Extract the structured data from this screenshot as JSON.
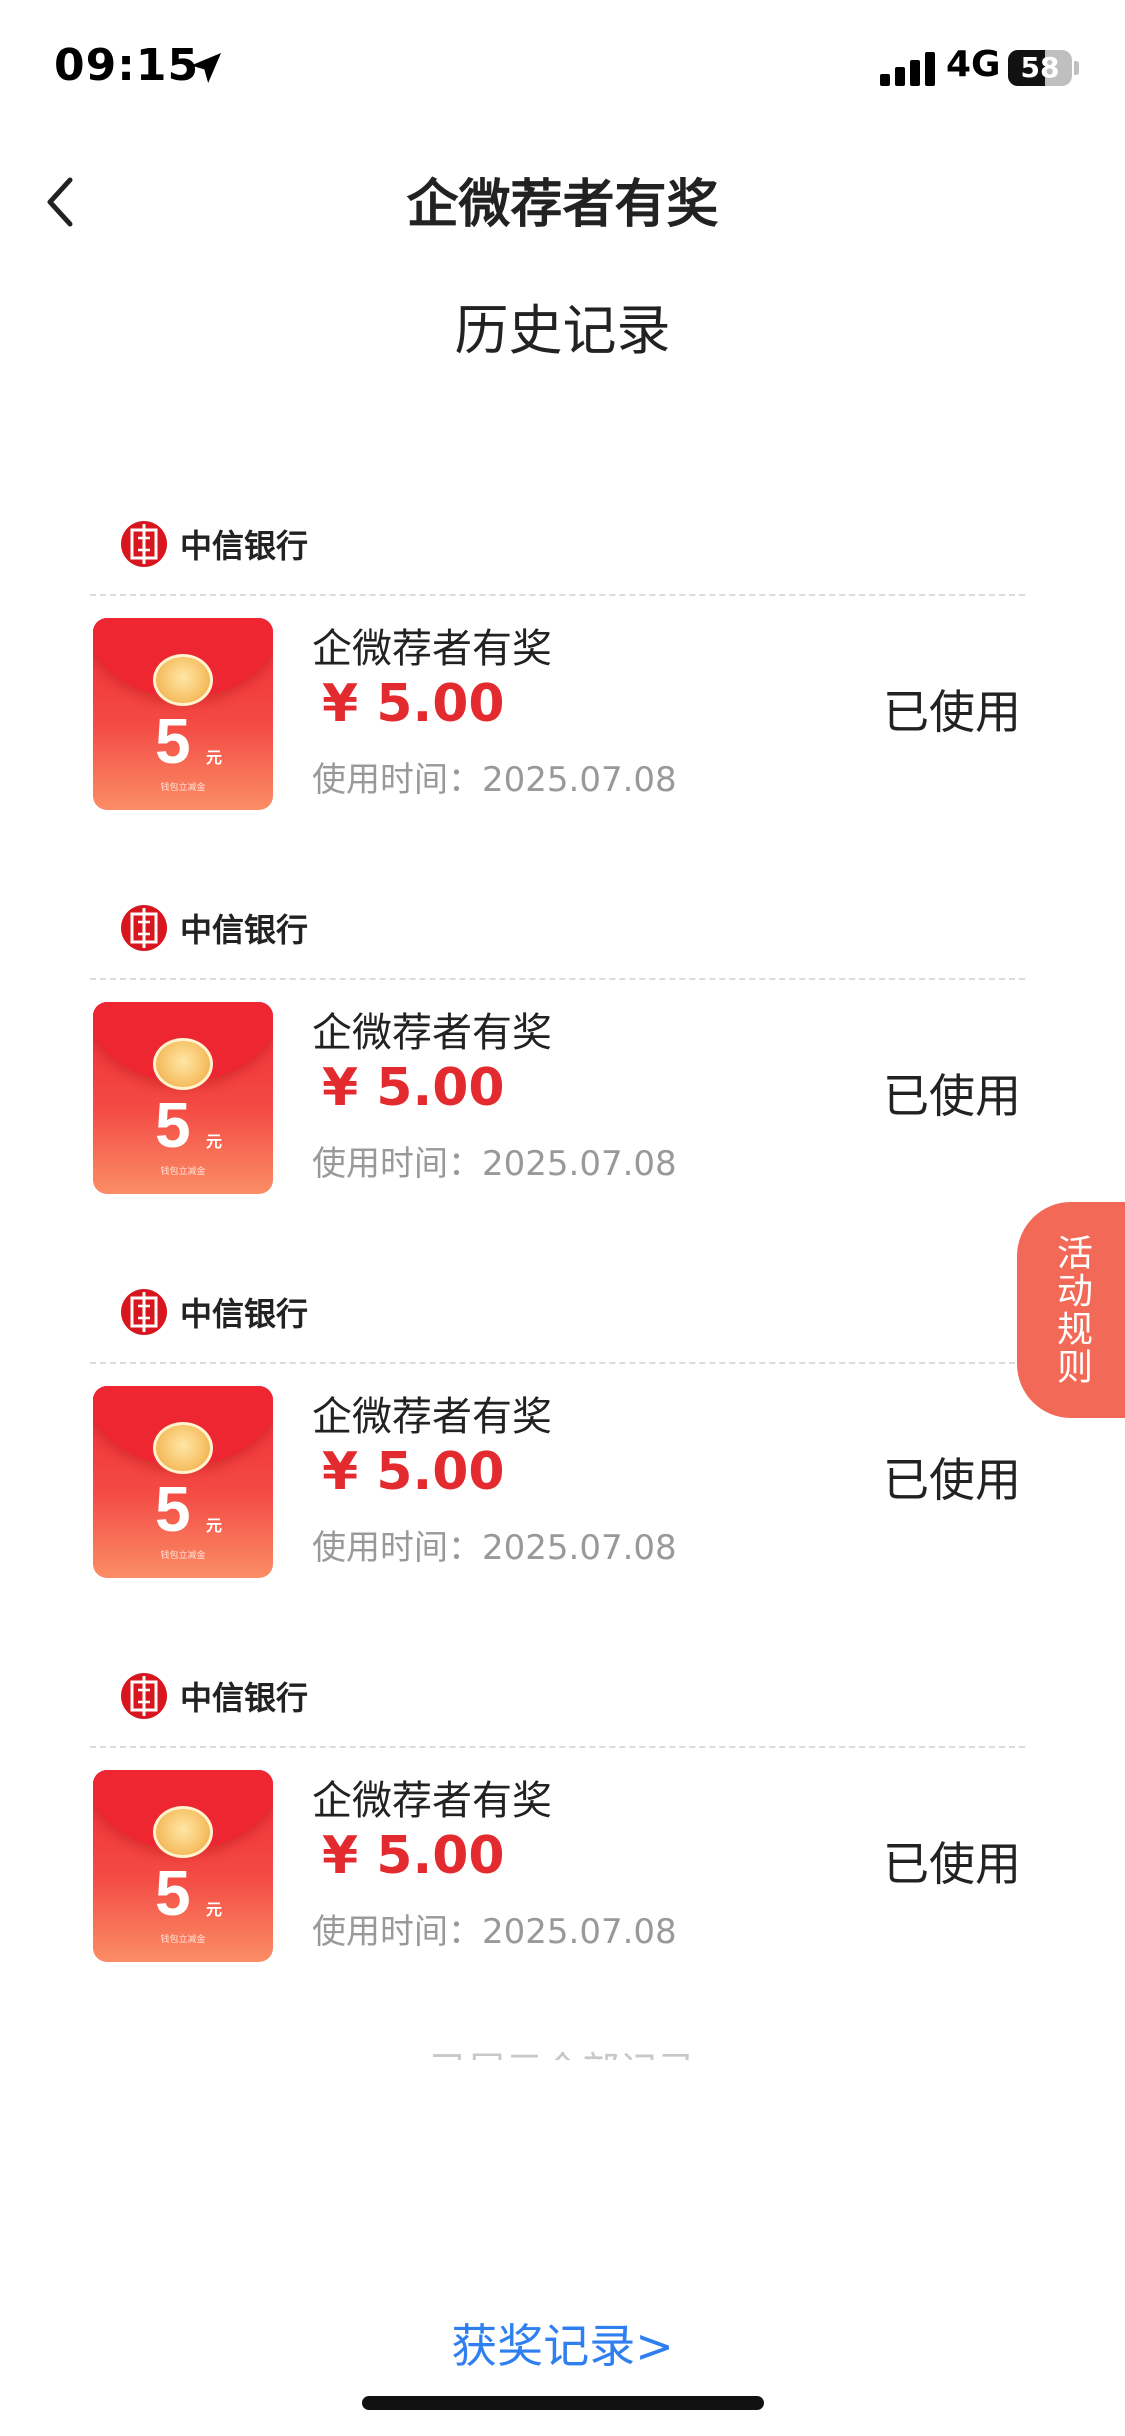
{
  "status_bar": {
    "time": "09:15",
    "network": "4G",
    "battery": "58",
    "battery_level": 0.58
  },
  "nav": {
    "title": "企微荐者有奖"
  },
  "section_title": "历史记录",
  "bank_name": "中信银行",
  "envelope": {
    "number": "5",
    "unit": "元",
    "note": "钱包立减金"
  },
  "records": [
    {
      "name": "企微荐者有奖",
      "amount": "¥ 5.00",
      "time": "使用时间：2025.07.08",
      "status": "已使用"
    },
    {
      "name": "企微荐者有奖",
      "amount": "¥ 5.00",
      "time": "使用时间：2025.07.08",
      "status": "已使用"
    },
    {
      "name": "企微荐者有奖",
      "amount": "¥ 5.00",
      "time": "使用时间：2025.07.08",
      "status": "已使用"
    },
    {
      "name": "企微荐者有奖",
      "amount": "¥ 5.00",
      "time": "使用时间：2025.07.08",
      "status": "已使用"
    }
  ],
  "footer_note": "已展示全部记录",
  "rules_tab": "活动规则",
  "bottom_link": "获奖记录>",
  "colors": {
    "amount": "#e32b2f",
    "link": "#2f7ff0",
    "rules_tab": "#f26a57",
    "bank_logo": "#d7161d"
  },
  "icons": {
    "back": "chevron-left-icon",
    "location": "location-arrow-icon",
    "signal": "cellular-signal-icon",
    "battery": "battery-icon"
  }
}
